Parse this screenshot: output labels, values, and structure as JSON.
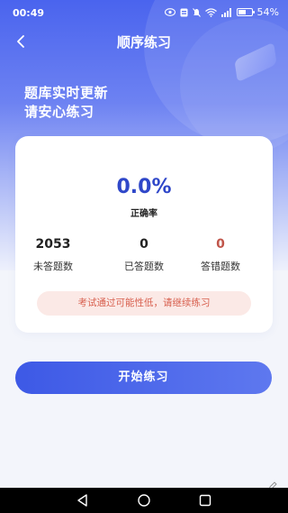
{
  "status_bar": {
    "time": "00:49",
    "battery_percent": "54%",
    "battery_level": 0.54
  },
  "nav": {
    "title": "顺序练习",
    "back_icon": "chevron-left-icon"
  },
  "headline": {
    "line1": "题库实时更新",
    "line2": "请安心练习"
  },
  "card": {
    "accuracy_value": "0.0%",
    "accuracy_label": "正确率",
    "stats": [
      {
        "value": "2053",
        "label": "未答题数"
      },
      {
        "value": "0",
        "label": "已答题数"
      },
      {
        "value": "0",
        "label": "答错题数"
      }
    ],
    "notice": "考试通过可能性低，请继续练习"
  },
  "actions": {
    "start_label": "开始练习"
  },
  "colors": {
    "brand_blue": "#3d59e6",
    "accuracy_blue": "#2f47c9",
    "wrong_red": "#c0554a",
    "notice_bg": "#fbe9e6",
    "notice_text": "#d8604f"
  },
  "system_nav": {
    "back_icon": "triangle-back-icon",
    "home_icon": "circle-home-icon",
    "recents_icon": "square-recents-icon"
  }
}
